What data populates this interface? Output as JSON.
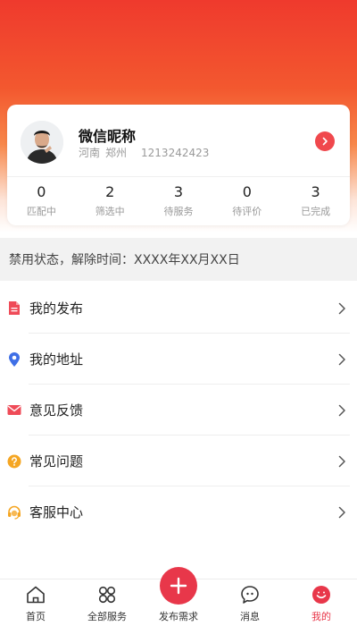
{
  "profile": {
    "nickname": "微信昵称",
    "province": "河南",
    "city": "郑州",
    "phone": "1213242423",
    "accent_color": "#f0484d"
  },
  "stats": [
    {
      "value": "0",
      "label": "匹配中"
    },
    {
      "value": "2",
      "label": "筛选中"
    },
    {
      "value": "3",
      "label": "待服务"
    },
    {
      "value": "0",
      "label": "待评价"
    },
    {
      "value": "3",
      "label": "已完成"
    }
  ],
  "banner": {
    "text": "禁用状态，解除时间：XXXX年XX月XX日"
  },
  "menu": [
    {
      "label": "我的发布",
      "icon": "document-icon",
      "color": "#ef4b58"
    },
    {
      "label": "我的地址",
      "icon": "location-pin-icon",
      "color": "#3f6fe6"
    },
    {
      "label": "意见反馈",
      "icon": "envelope-icon",
      "color": "#ef4b58"
    },
    {
      "label": "常见问题",
      "icon": "question-circle-icon",
      "color": "#f5a623"
    },
    {
      "label": "客服中心",
      "icon": "headset-icon",
      "color": "#f5a623"
    }
  ],
  "tabs": [
    {
      "label": "首页",
      "icon": "home-icon"
    },
    {
      "label": "全部服务",
      "icon": "grid-icon"
    },
    {
      "label": "发布需求",
      "icon": "plus-icon"
    },
    {
      "label": "消息",
      "icon": "chat-bubble-icon"
    },
    {
      "label": "我的",
      "icon": "profile-face-icon",
      "active": true
    }
  ]
}
